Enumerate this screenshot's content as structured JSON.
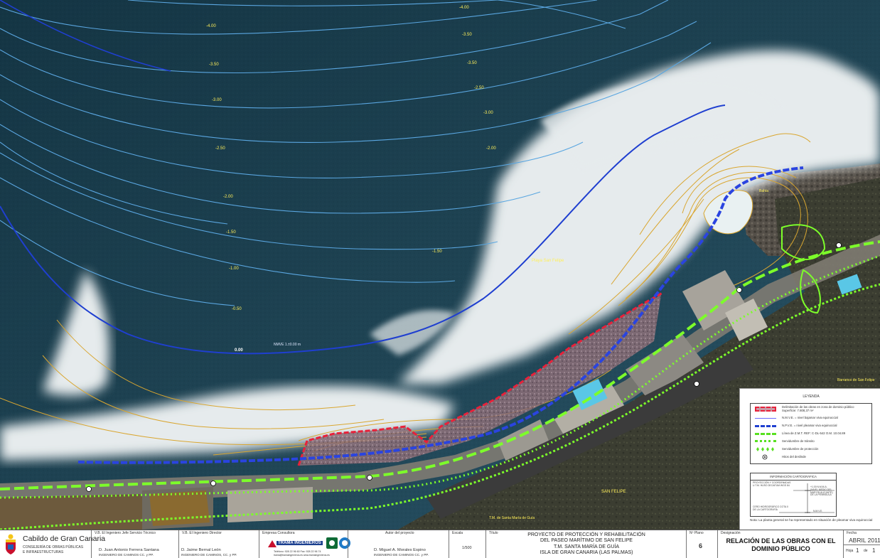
{
  "map": {
    "depth_labels": [
      "-4.00",
      "-4.00",
      "-3.50",
      "-3.50",
      "-3.50",
      "-3.00",
      "-3.00",
      "-2.50",
      "-2.50",
      "-2.00",
      "-2.00",
      "-1.50",
      "-1.50",
      "-1.00",
      "-0.50",
      "0.00"
    ],
    "nmve_label": "NMVE 1.±0.00 m",
    "place_labels": {
      "playa": "Playa San Felipe",
      "san_felipe": "SAN FELIPE",
      "barranco": "Barranco de San Felipe",
      "gc": "T.M. de Santa María de Guía",
      "bahia": "Bahía"
    },
    "colors": {
      "sea_dark": "#17394a",
      "red_boundary": "#e8213a",
      "blue_nmve": "#1f3fd0",
      "green_zmt": "#7dff2a",
      "contour_orange": "#d9a630",
      "contour_blue": "#5aa6e0"
    }
  },
  "legend": {
    "title": "LEYENDA",
    "items": [
      {
        "icon": "red-polygon-icon",
        "text": "Delimitación de las obras en zona de dominio público",
        "text2": "Superficie: 7.808,37 m²"
      },
      {
        "icon": "thin-line-icon",
        "text": "N.M.V.E. = nivel bajamar viva equinoccial"
      },
      {
        "icon": "blue-dash-icon",
        "text": "N.P.V.E. = nivel pleamar viva equinoccial"
      },
      {
        "icon": "green-dash-icon",
        "text": "Línea de Z.M.T. REF: C-DL-542 O.M. 10.04.89"
      },
      {
        "icon": "green-dot-icon",
        "text": "Servidumbre de tránsito"
      },
      {
        "icon": "green-diamond-icon",
        "text": "Servidumbre de protección"
      },
      {
        "icon": "circle-dot-icon",
        "text": "Hitos del deslinde"
      }
    ],
    "carto": {
      "title": "INFORMACIÓN CARTOGRÁFICA",
      "left_text": "PROYECCIÓN Y COORDENADAS U.T.M. HUSO 28 DATUM WGS 84",
      "right_text": "+1.00 N.M.M.A. (NIVEL MEDIO DEL MAR EN ALICANTE) DE LA PENÍNSULA",
      "bottom_left": "CERO HIDROGRÁFICO COTA 0 DE LA CARTOGRAFÍA",
      "nmve": "N.M.V.E."
    },
    "note": "Nota: La planta general se ha representado en situación de pleamar viva equinoccial"
  },
  "titleblock": {
    "org_name": "Cabildo de Gran Canaria",
    "org_sub1": "CONSEJERÍA DE OBRAS PÚBLICAS",
    "org_sub2": "E INFRAESTRUCTURAS",
    "vb_jefe_label": "V.B. El Ingeniero Jefe Servicio Técnico",
    "vb_jefe_name": "D. Juan Antonio Ferrera Santana",
    "vb_jefe_title": "INGENIERO DE CAMINOS CC. y PP.",
    "vb_dir_label": "V.B. El Ingeniero Director",
    "vb_dir_name": "D. Jaime Bernal León",
    "vb_dir_title": "INGENIERO DE CAMINOS, CC. y PP.",
    "empresa_label": "Empresa Consultora",
    "empresa_name": "TRAMA INGENIEROS",
    "empresa_contact": "Teléfono: 928 22 96 60 Fax: 928 22 96 74",
    "empresa_web": "trama@tramaingenieros.es   www.tramaingenieros.es",
    "autor_label": "Autor del proyecto",
    "autor_name": "D. Miguel A. Morales Espino",
    "autor_title": "INGENIERO DE CAMINOS CC. y PP.",
    "escala_label": "Escala",
    "escala_value": "1/500",
    "titulo_label": "Título",
    "titulo_l1": "PROYECTO DE PROTECCIÓN Y REHABILITACIÓN",
    "titulo_l2": "DEL PASEO MARÍTIMO DE SAN FELIPE",
    "titulo_l3": "T.M. SANTA MARÍA DE GUÍA",
    "titulo_l4": "ISLA DE GRAN CANARIA (LAS PALMAS)",
    "nplano_label": "Nº Plano",
    "nplano_value": "6",
    "design_label": "Designación",
    "design_l1": "RELACIÓN DE LAS OBRAS CON EL",
    "design_l2": "DOMINIO PÚBLICO",
    "fecha_label": "Fecha",
    "fecha_value": "ABRIL 2011",
    "hoja_label": "Hoja",
    "hoja_num": "1",
    "hoja_de": "de",
    "hoja_total": "1"
  }
}
